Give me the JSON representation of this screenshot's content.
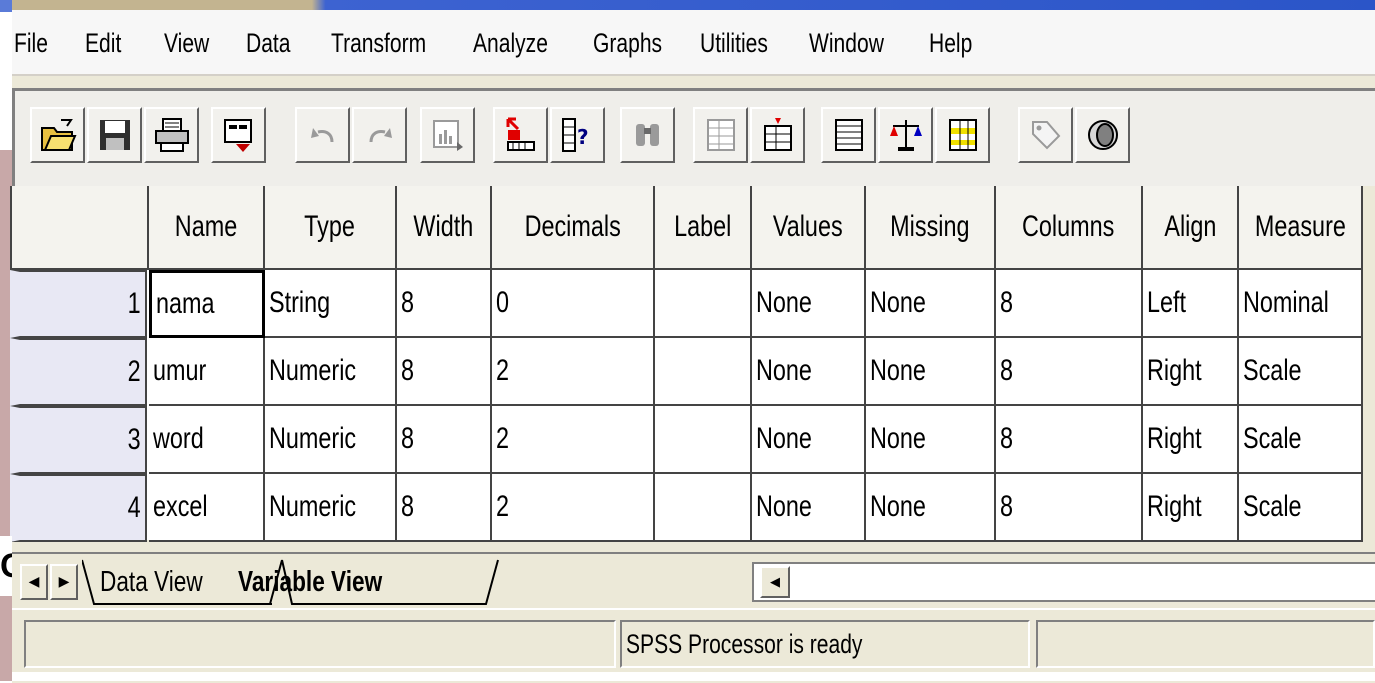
{
  "menubar": {
    "items": [
      "File",
      "Edit",
      "View",
      "Data",
      "Transform",
      "Analyze",
      "Graphs",
      "Utilities",
      "Window",
      "Help"
    ]
  },
  "toolbar": {
    "icons": [
      "open-folder-icon",
      "save-disk-icon",
      "print-icon",
      "dialog-recall-icon",
      "undo-icon",
      "redo-icon",
      "goto-chart-icon",
      "goto-case-icon",
      "variables-icon",
      "find-binoculars-icon",
      "insert-case-icon",
      "insert-variable-icon",
      "split-file-icon",
      "weight-cases-icon",
      "select-cases-icon",
      "value-labels-icon",
      "use-sets-icon"
    ]
  },
  "grid": {
    "columns": [
      "Name",
      "Type",
      "Width",
      "Decimals",
      "Label",
      "Values",
      "Missing",
      "Columns",
      "Align",
      "Measure"
    ],
    "rows": [
      {
        "num": "1",
        "cells": [
          "nama",
          "String",
          "8",
          "0",
          "",
          "None",
          "None",
          "8",
          "Left",
          "Nominal"
        ]
      },
      {
        "num": "2",
        "cells": [
          "umur",
          "Numeric",
          "8",
          "2",
          "",
          "None",
          "None",
          "8",
          "Right",
          "Scale"
        ]
      },
      {
        "num": "3",
        "cells": [
          "word",
          "Numeric",
          "8",
          "2",
          "",
          "None",
          "None",
          "8",
          "Right",
          "Scale"
        ]
      },
      {
        "num": "4",
        "cells": [
          "excel",
          "Numeric",
          "8",
          "2",
          "",
          "None",
          "None",
          "8",
          "Right",
          "Scale"
        ]
      }
    ]
  },
  "tabs": {
    "data_view": "Data View",
    "variable_view": "Variable View",
    "active": "Variable View"
  },
  "statusbar": {
    "message": "SPSS Processor  is ready"
  },
  "colors": {
    "titlebar_blue": "#2b55c8",
    "row_header_bg": "#e8e8f4",
    "window_bg": "#ece9d8"
  }
}
